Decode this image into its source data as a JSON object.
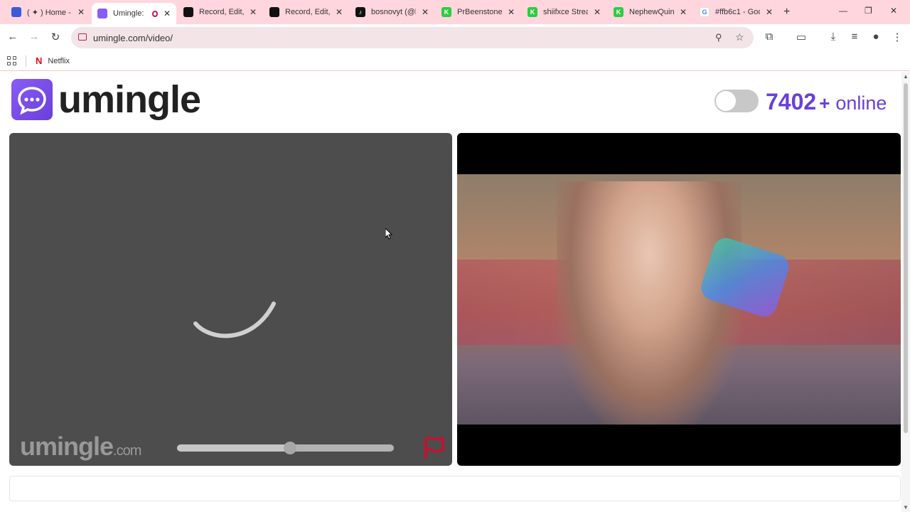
{
  "browser": {
    "tabs": [
      {
        "title": "( ✦ ) Home - ",
        "favicon_color": "#3b5bdb",
        "glyph": ""
      },
      {
        "title": "Umingle: ",
        "favicon_color": "#8a5cf5",
        "glyph": "",
        "active": true,
        "recording": true
      },
      {
        "title": "Record, Edit, ",
        "favicon_color": "#111111",
        "glyph": ""
      },
      {
        "title": "Record, Edit, ",
        "favicon_color": "#111111",
        "glyph": ""
      },
      {
        "title": "bosnovyt (@b",
        "favicon_color": "#111111",
        "glyph": "♪"
      },
      {
        "title": "PrBeenstone ",
        "favicon_color": "#2ecc40",
        "glyph": "K"
      },
      {
        "title": "shiifxce Strea",
        "favicon_color": "#2ecc40",
        "glyph": "K"
      },
      {
        "title": "NephewQuin",
        "favicon_color": "#2ecc40",
        "glyph": "K"
      },
      {
        "title": "#ffb6c1 - Goo",
        "favicon_color": "#ffffff",
        "glyph": "G"
      }
    ],
    "url": "umingle.com/video/",
    "bookmarks": [
      {
        "label": "Netflix"
      }
    ]
  },
  "site": {
    "logo_text": "umingle",
    "online_count": "7402",
    "online_plus": "+",
    "online_label": "online",
    "watermark_main": "umingle",
    "watermark_suffix": ".com",
    "volume_level": 0.52,
    "accent_color": "#6a3fd9",
    "flag_color": "#c8102e"
  }
}
